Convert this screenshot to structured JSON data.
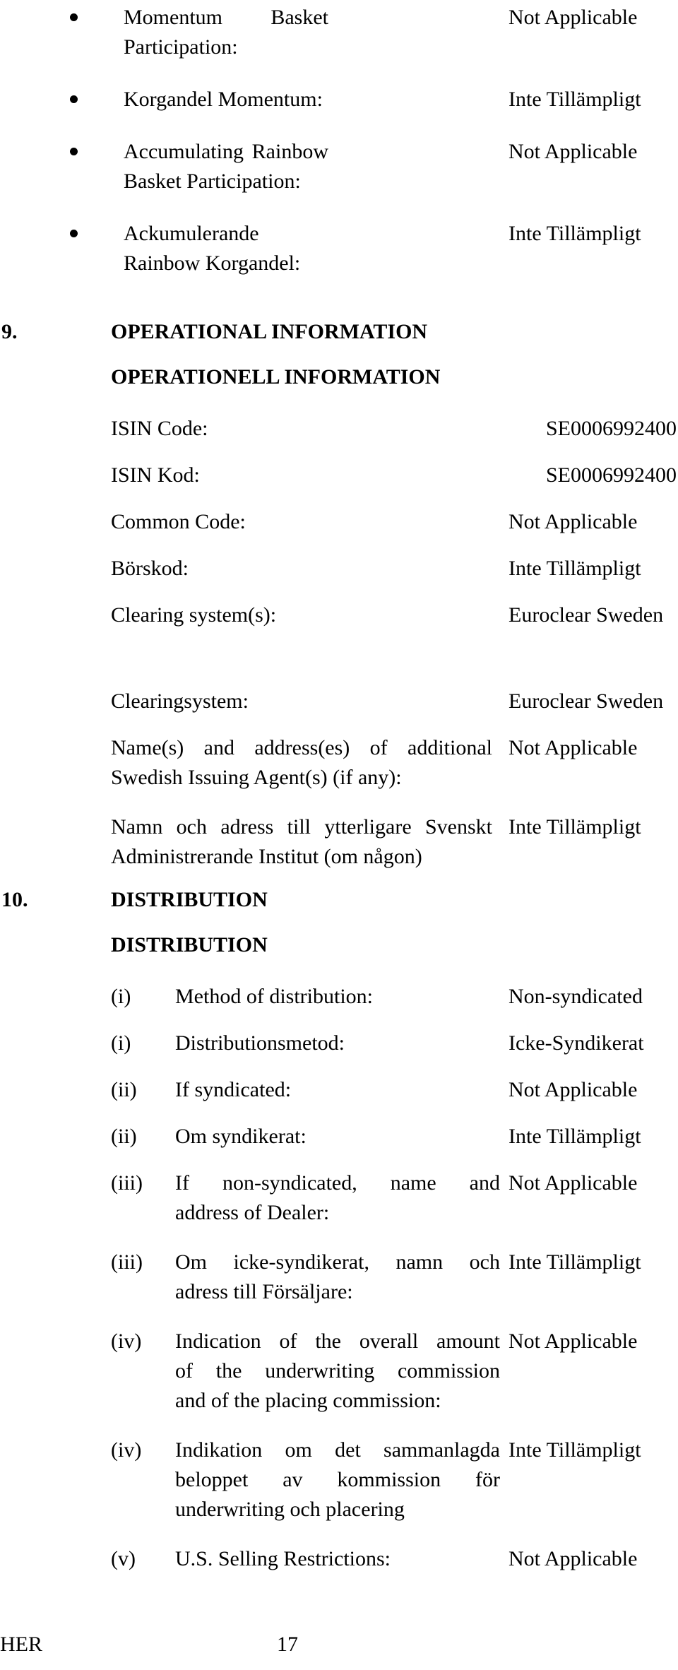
{
  "document": {
    "bullets_top": [
      {
        "label": "Momentum Basket Participation:",
        "value": "Not Applicable",
        "two_line": true
      },
      {
        "label": "Korgandel Momentum:",
        "value": "Inte Tillämpligt",
        "two_line": false
      },
      {
        "label": "Accumulating Rainbow Basket Participation:",
        "value": "Not Applicable",
        "two_line": true
      },
      {
        "label": "Ackumulerande Rainbow Korgandel:",
        "value": "Inte Tillämpligt",
        "two_line": true
      }
    ],
    "section_9": {
      "number": "9.",
      "heading_en": "OPERATIONAL INFORMATION",
      "heading_sv": "OPERATIONELL INFORMATION",
      "rows": [
        {
          "label": "ISIN Code:",
          "value": "SE0006992400",
          "align": "right"
        },
        {
          "label": "ISIN Kod:",
          "value": "SE0006992400",
          "align": "right"
        },
        {
          "label": "Common Code:",
          "value": "Not Applicable",
          "align": "left"
        },
        {
          "label": "Börskod:",
          "value": "Inte Tillämpligt",
          "align": "left"
        },
        {
          "label": "Clearing system(s):",
          "value": "Euroclear Sweden",
          "align": "left"
        },
        {
          "label": "Clearingsystem:",
          "value": "Euroclear Sweden",
          "align": "left"
        }
      ],
      "wrap_rows": [
        {
          "label_line1": "Name(s) and address(es) of additional",
          "label_line2": "Swedish Issuing Agent(s) (if any):",
          "value": "Not Applicable"
        },
        {
          "label_line1": "Namn och adress till ytterligare Svenskt",
          "label_line2": "Administrerande Institut (om någon)",
          "value": "Inte Tillämpligt"
        }
      ]
    },
    "section_10": {
      "number": "10.",
      "heading_en": "DISTRIBUTION",
      "heading_sv": "DISTRIBUTION",
      "items": [
        {
          "roman": "(i)",
          "label": "Method of distribution:",
          "value": "Non-syndicated",
          "lines": 1
        },
        {
          "roman": "(i)",
          "label": "Distributionsmetod:",
          "value": "Icke-Syndikerat",
          "lines": 1
        },
        {
          "roman": "(ii)",
          "label": "If syndicated:",
          "value": "Not Applicable",
          "lines": 1
        },
        {
          "roman": "(ii)",
          "label": "Om syndikerat:",
          "value": "Inte Tillämpligt",
          "lines": 1
        },
        {
          "roman": "(iii)",
          "label_line1": "If non-syndicated, name and",
          "label_line2": "address of Dealer:",
          "value": "Not Applicable",
          "lines": 2
        },
        {
          "roman": "(iii)",
          "label_line1": "Om icke-syndikerat, namn och",
          "label_line2": "adress till Försäljare:",
          "value": "Inte Tillämpligt",
          "lines": 2
        },
        {
          "roman": "(iv)",
          "label_line1": "Indication of the overall amount",
          "label_line2": "of the underwriting commission",
          "label_line3": "and of the placing commission:",
          "value": "Not Applicable",
          "lines": 3
        },
        {
          "roman": "(iv)",
          "label_line1": "Indikation om det sammanlagda",
          "label_line2": "beloppet av kommission för",
          "label_line3": "underwriting och placering",
          "value": "Inte Tillämpligt",
          "lines": 3
        },
        {
          "roman": "(v)",
          "label": "U.S. Selling Restrictions:",
          "value": "Not Applicable",
          "lines": 1
        }
      ]
    },
    "footer": {
      "left": "HER",
      "page_number": "17"
    }
  }
}
